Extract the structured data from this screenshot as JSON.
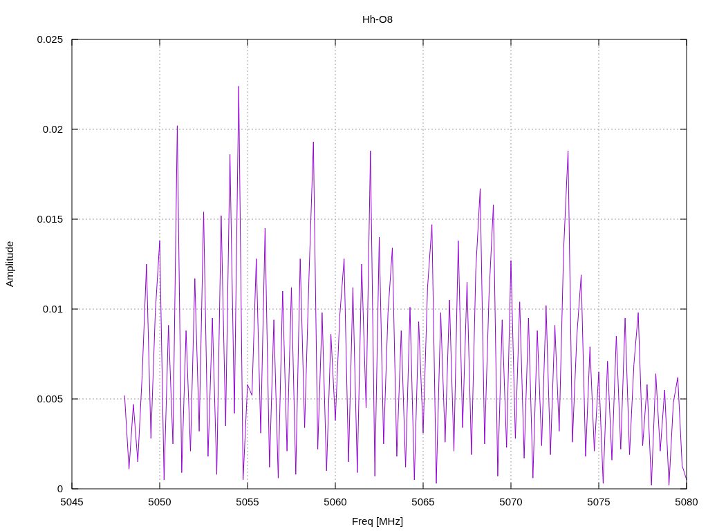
{
  "chart_data": {
    "type": "line",
    "title": "Hh-O8",
    "xlabel": "Freq [MHz]",
    "ylabel": "Amplitude",
    "grid": true,
    "xlim": [
      5045,
      5080
    ],
    "ylim": [
      0,
      0.025
    ],
    "xticks": [
      5045,
      5050,
      5055,
      5060,
      5065,
      5070,
      5075,
      5080
    ],
    "yticks": [
      {
        "value": 0,
        "label": "0"
      },
      {
        "value": 0.005,
        "label": "0.005"
      },
      {
        "value": 0.01,
        "label": "0.01"
      },
      {
        "value": 0.015,
        "label": "0.015"
      },
      {
        "value": 0.02,
        "label": "0.02"
      },
      {
        "value": 0.025,
        "label": "0.025"
      }
    ],
    "x": [
      5048,
      5048.25,
      5048.5,
      5048.75,
      5049,
      5049.25,
      5049.5,
      5049.75,
      5050,
      5050.25,
      5050.5,
      5050.75,
      5051,
      5051.25,
      5051.5,
      5051.75,
      5052,
      5052.25,
      5052.5,
      5052.75,
      5053,
      5053.25,
      5053.5,
      5053.75,
      5054,
      5054.25,
      5054.5,
      5054.75,
      5055,
      5055.25,
      5055.5,
      5055.75,
      5056,
      5056.25,
      5056.5,
      5056.75,
      5057,
      5057.25,
      5057.5,
      5057.75,
      5058,
      5058.25,
      5058.5,
      5058.75,
      5059,
      5059.25,
      5059.5,
      5059.75,
      5060,
      5060.25,
      5060.5,
      5060.75,
      5061,
      5061.25,
      5061.5,
      5061.75,
      5062,
      5062.25,
      5062.5,
      5062.75,
      5063,
      5063.25,
      5063.5,
      5063.75,
      5064,
      5064.25,
      5064.5,
      5064.75,
      5065,
      5065.25,
      5065.5,
      5065.75,
      5066,
      5066.25,
      5066.5,
      5066.75,
      5067,
      5067.25,
      5067.5,
      5067.75,
      5068,
      5068.25,
      5068.5,
      5068.75,
      5069,
      5069.25,
      5069.5,
      5069.75,
      5070,
      5070.25,
      5070.5,
      5070.75,
      5071,
      5071.25,
      5071.5,
      5071.75,
      5072,
      5072.25,
      5072.5,
      5072.75,
      5073,
      5073.25,
      5073.5,
      5073.75,
      5074,
      5074.25,
      5074.5,
      5074.75,
      5075,
      5075.25,
      5075.5,
      5075.75,
      5076,
      5076.25,
      5076.5,
      5076.75,
      5077,
      5077.25,
      5077.5,
      5077.75,
      5078,
      5078.25,
      5078.5,
      5078.75,
      5079,
      5079.25,
      5079.5,
      5079.75,
      5080
    ],
    "series": [
      {
        "color": "#9400d3",
        "values": [
          0.0052,
          0.0011,
          0.0047,
          0.0015,
          0.0063,
          0.0125,
          0.0028,
          0.0098,
          0.0138,
          0.0005,
          0.0091,
          0.0025,
          0.0202,
          0.0009,
          0.0088,
          0.0021,
          0.0117,
          0.0032,
          0.0154,
          0.0018,
          0.0095,
          0.0008,
          0.0152,
          0.0035,
          0.0186,
          0.0042,
          0.0224,
          0.0005,
          0.0058,
          0.0052,
          0.0128,
          0.0031,
          0.0145,
          0.0012,
          0.0094,
          0.0006,
          0.011,
          0.0021,
          0.0112,
          0.0008,
          0.0128,
          0.0034,
          0.0118,
          0.0193,
          0.0022,
          0.0098,
          0.001,
          0.0086,
          0.0038,
          0.0096,
          0.0128,
          0.0015,
          0.0112,
          0.0009,
          0.0125,
          0.0045,
          0.0188,
          0.0007,
          0.014,
          0.0025,
          0.0098,
          0.0134,
          0.0018,
          0.0088,
          0.0012,
          0.0101,
          0.0005,
          0.0093,
          0.0031,
          0.0112,
          0.0147,
          0.0003,
          0.0098,
          0.0026,
          0.0105,
          0.0021,
          0.0138,
          0.0034,
          0.0115,
          0.0019,
          0.0122,
          0.0167,
          0.0025,
          0.0108,
          0.0158,
          0.0007,
          0.0094,
          0.0023,
          0.0127,
          0.0028,
          0.0104,
          0.0017,
          0.0095,
          0.0006,
          0.0088,
          0.0024,
          0.0102,
          0.0019,
          0.0091,
          0.0032,
          0.0133,
          0.0188,
          0.0026,
          0.0085,
          0.0119,
          0.0018,
          0.0079,
          0.0021,
          0.0065,
          0.0003,
          0.0071,
          0.0016,
          0.0085,
          0.0022,
          0.0095,
          0.0019,
          0.0069,
          0.0098,
          0.0024,
          0.0058,
          0.0002,
          0.0064,
          0.0021,
          0.0055,
          0.0002,
          0.0048,
          0.0062,
          0.0013,
          0.0005
        ]
      }
    ]
  }
}
